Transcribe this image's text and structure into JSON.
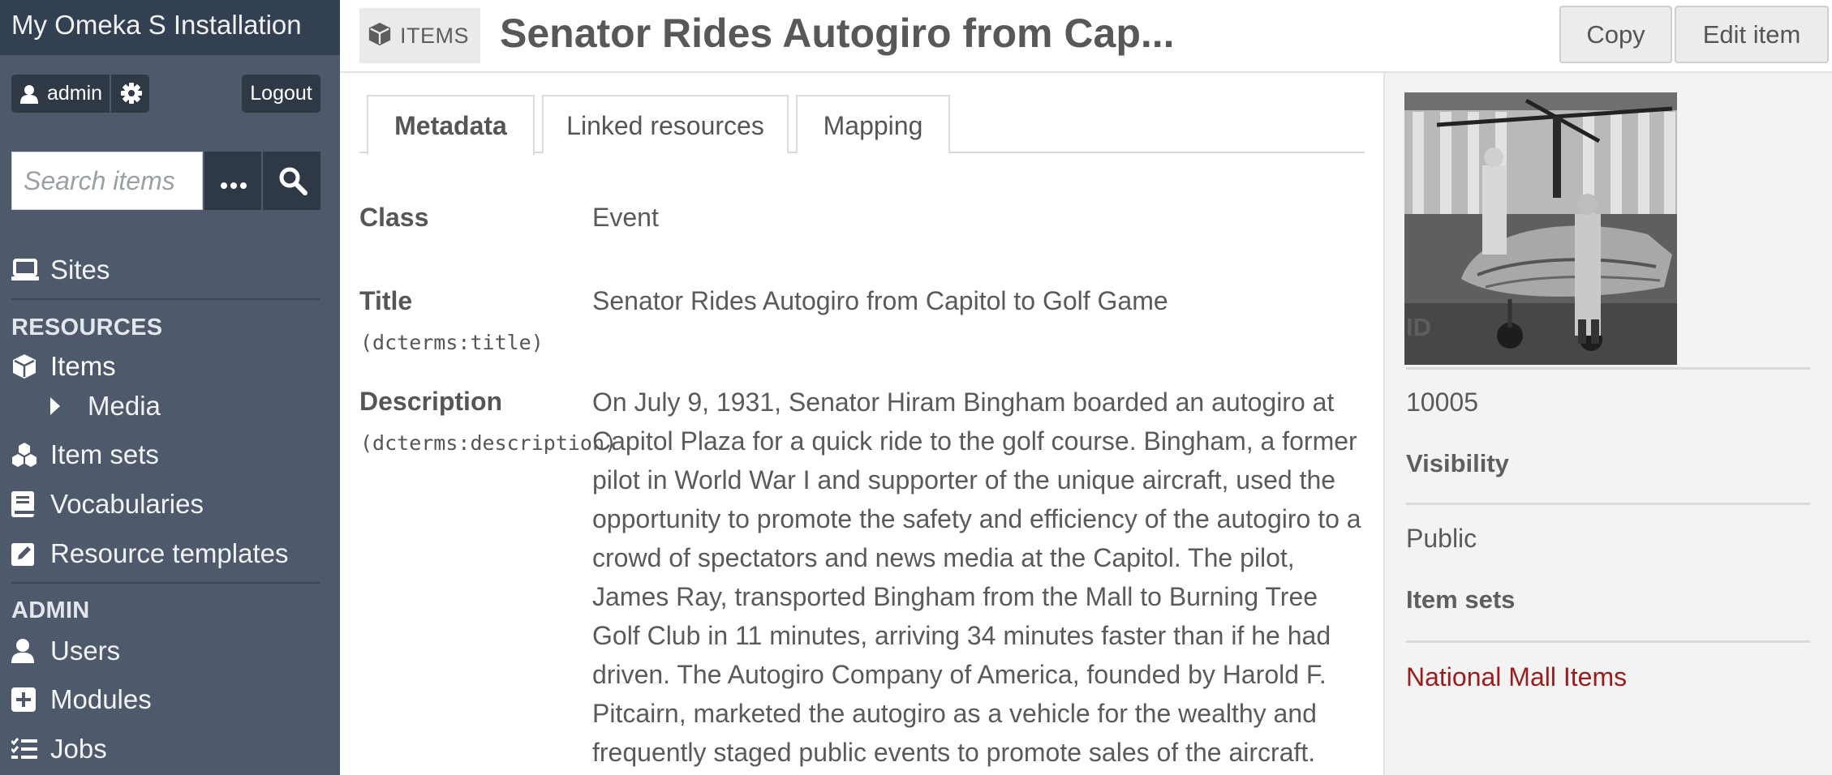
{
  "brand": {
    "title": "My Omeka S Installation"
  },
  "user": {
    "name": "admin",
    "logout_label": "Logout"
  },
  "search": {
    "placeholder": "Search items",
    "value": ""
  },
  "nav": {
    "sites_label": "Sites",
    "resources_header": "RESOURCES",
    "items_label": "Items",
    "media_label": "Media",
    "item_sets_label": "Item sets",
    "vocabularies_label": "Vocabularies",
    "resource_templates_label": "Resource templates",
    "admin_header": "ADMIN",
    "users_label": "Users",
    "modules_label": "Modules",
    "jobs_label": "Jobs"
  },
  "header": {
    "badge_label": "ITEMS",
    "title": "Senator Rides Autogiro from Cap...",
    "copy_label": "Copy",
    "edit_label": "Edit item"
  },
  "tabs": [
    {
      "label": "Metadata",
      "active": true
    },
    {
      "label": "Linked resources",
      "active": false
    },
    {
      "label": "Mapping",
      "active": false
    }
  ],
  "metadata": {
    "class_label": "Class",
    "class_value": "Event",
    "title_label": "Title",
    "title_term": "(dcterms:title)",
    "title_value": "Senator Rides Autogiro from Capitol to Golf Game",
    "description_label": "Description",
    "description_term": "(dcterms:description)",
    "description_value": "On July 9, 1931, Senator Hiram Bingham boarded an autogiro at Capitol Plaza for a quick ride to the golf course. Bingham, a former pilot in World War I and supporter of the unique aircraft, used the opportunity to promote the safety and efficiency of the autogiro to a crowd of spectators and news media at the Capitol. The pilot, James Ray, transported Bingham from the Mall to Burning Tree Golf Club in 11 minutes, arriving 34 minutes faster than if he had driven. The Autogiro Company of America, founded by Harold F. Pitcairn, marketed the autogiro as a vehicle for the wealthy and frequently staged public events to promote sales of the aircraft."
  },
  "sidebar_right": {
    "id_label": "ID",
    "id_value": "10005",
    "visibility_label": "Visibility",
    "visibility_value": "Public",
    "item_sets_label": "Item sets",
    "item_sets_value": "National Mall Items"
  },
  "colors": {
    "sidebar_bg": "#4e5a6c",
    "brand_bg": "#334051",
    "link_red": "#9b1c1c",
    "panel_bg": "#f3f3f3"
  },
  "icons": {
    "user": "user-icon",
    "gear": "gear-icon",
    "more": "ellipsis-icon",
    "search": "search-icon",
    "sites": "laptop-icon",
    "items": "cube-icon",
    "media": "caret-right-icon",
    "item_sets": "cubes-icon",
    "vocabularies": "book-icon",
    "resource_templates": "pencil-square-icon",
    "users": "user-icon",
    "modules": "plus-square-icon",
    "jobs": "list-check-icon"
  }
}
